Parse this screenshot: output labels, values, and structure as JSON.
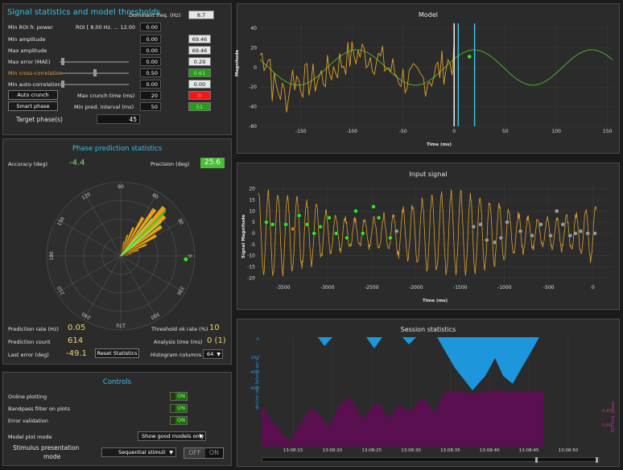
{
  "signal_panel": {
    "title": "Signal statistics and model thresholds",
    "dominant_freq_label": "Dominant freq. (Hz)",
    "dominant_freq_value": "8.7",
    "min_roi_label": "Min ROI fr. power",
    "roi_label": "ROI [ 8.00 Hz. ... 12.00",
    "roi_value": "0.00",
    "rows": [
      {
        "label": "Min amplitude",
        "value": "0.00",
        "indicator": "69.46",
        "ind_color": "#e6e6e6",
        "ind_text": "#111111"
      },
      {
        "label": "Max amplitude",
        "value": "0.00",
        "indicator": "69.46",
        "ind_color": "#e6e6e6",
        "ind_text": "#111111"
      },
      {
        "label": "Max error (MAE)",
        "value": "0.00",
        "indicator": "0.29",
        "ind_color": "#e6e6e6",
        "ind_text": "#111111"
      },
      {
        "label": "Min cross-correlation",
        "value": "0.50",
        "indicator": "0.61",
        "ind_color": "#2a9a1c",
        "ind_text": "#9bff6a"
      },
      {
        "label": "Min auto-correlation",
        "value": "0.00",
        "indicator": "0.00",
        "ind_color": "#e6e6e6",
        "ind_text": "#111111"
      }
    ],
    "auto_crunch_label": "Auto crunch",
    "max_crunch_label": "Max crunch time (ms)",
    "max_crunch_value": "20",
    "max_crunch_indicator": "0",
    "smart_phase_label": "Smart phase",
    "min_pred_label": "Min pred. interval (ms)",
    "min_pred_value": "50",
    "min_pred_indicator": "51",
    "target_phase_label": "Target phase(s)",
    "target_phase_value": "45"
  },
  "phase_panel": {
    "title": "Phase prediction statistics",
    "accuracy_label": "Accuracy (deg)",
    "accuracy_value": "-4.4",
    "precision_label": "Precision (deg)",
    "precision_value": "25.6",
    "polar_labels": [
      "0",
      "30",
      "60",
      "90",
      "120",
      "150",
      "180",
      "210",
      "240",
      "270",
      "300",
      "330"
    ],
    "prediction_rate_label": "Prediction rate (Hz)",
    "prediction_rate_value": "0.05",
    "threshold_ok_label": "Threshold ok rate (%)",
    "threshold_ok_value": "10",
    "prediction_count_label": "Prediction count",
    "prediction_count_value": "614",
    "analysis_time_label": "Analysis time (ms)",
    "analysis_time_value": "0 (1)",
    "last_error_label": "Last error (deg)",
    "last_error_value": "-49.1",
    "reset_label": "Reset Statistics",
    "hist_cols_label": "Histogram columns",
    "hist_cols_value": "64"
  },
  "controls_panel": {
    "title": "Controls",
    "toggles": [
      {
        "label": "Online plotting",
        "state": "ON"
      },
      {
        "label": "Bandpass filter on plots",
        "state": "ON"
      },
      {
        "label": "Error validation",
        "state": "ON"
      }
    ],
    "model_plot_label": "Model plot mode",
    "model_plot_value": "Show good models only",
    "stimulus_label_1": "Stimulus presentation",
    "stimulus_label_2": "mode",
    "stimulus_value": "Sequential stimuli",
    "off_label": "OFF",
    "on_label": "ON"
  },
  "model_chart": {
    "title": "Model",
    "ylabel": "Magnitude",
    "xlabel": "Time (ms)",
    "xticks": [
      "-150",
      "-100",
      "-50",
      "0",
      "50",
      "100",
      "150"
    ],
    "yticks": [
      "40",
      "20",
      "0",
      "-20",
      "-40",
      "-60"
    ]
  },
  "input_chart": {
    "title": "Input signal",
    "ylabel": "Signal Magnitude",
    "xlabel": "Time (ms)",
    "xticks": [
      "-3500",
      "-3000",
      "-2500",
      "-2000",
      "-1500",
      "-1000",
      "-500",
      "0"
    ],
    "yticks": [
      "20",
      "15",
      "10",
      "5",
      "0",
      "-5",
      "-10",
      "-15",
      "-20"
    ]
  },
  "session_chart": {
    "title": "Session statistics",
    "left_axis_label": "decline rate failures per s",
    "right_axis_label": "ROI freq. power",
    "left_ticks": [
      "0",
      "-200",
      "-400",
      "-600"
    ],
    "right_ticks": [
      "0.80",
      "0.60"
    ],
    "xticks": [
      "13:08:15",
      "13:08:20",
      "13:08:25",
      "13:08:30",
      "13:08:35",
      "13:08:40",
      "13:08:45",
      "13:08:50"
    ]
  },
  "colors": {
    "accent": "#35c3e8",
    "signal_orange": "#e0a12a",
    "model_green": "#4caf2a",
    "session_blue": "#1e96dc",
    "session_purple": "#5a1050"
  }
}
